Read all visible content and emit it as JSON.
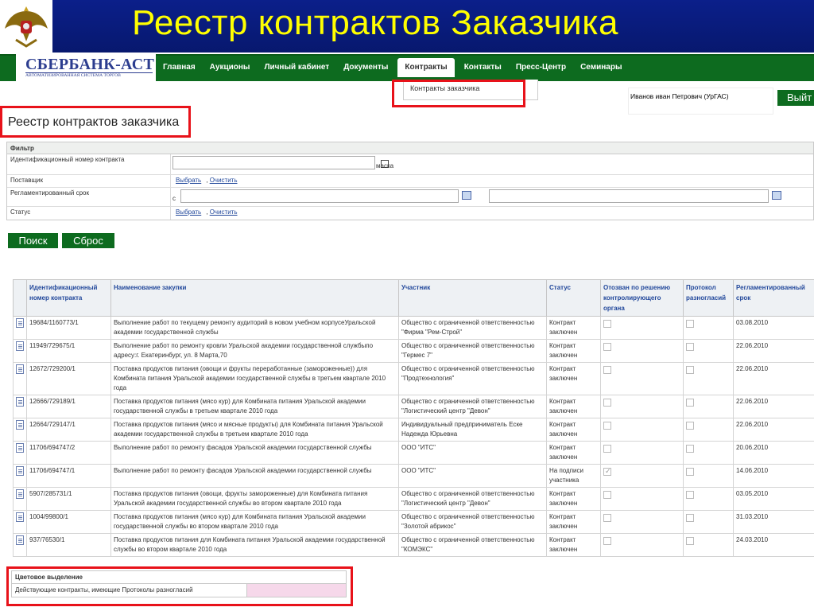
{
  "slide": {
    "title": "Реестр контрактов Заказчика"
  },
  "logo": {
    "main": "СБЕРБАНК-АСТ",
    "sub": "АВТОМАТИЗИРОВАННАЯ СИСТЕМА ТОРГОВ"
  },
  "nav": {
    "items": [
      {
        "label": "Главная"
      },
      {
        "label": "Аукционы"
      },
      {
        "label": "Личный кабинет"
      },
      {
        "label": "Документы"
      },
      {
        "label": "Контракты",
        "active": true
      },
      {
        "label": "Контакты"
      },
      {
        "label": "Пресс-Центр"
      },
      {
        "label": "Семинары"
      }
    ],
    "dropdown_item": "Контракты заказчика"
  },
  "user": {
    "name": "Иванов иван Петрович (УрГАС)",
    "logout": "Выйт"
  },
  "page": {
    "title": "Реестр контрактов заказчика"
  },
  "filter": {
    "header": "Фильтр",
    "contract_number_label": "Идентификационный номер контракта",
    "mask_label": "маска",
    "supplier_label": "Поставщик",
    "reg_term_label": "Регламентированный срок",
    "from_label": "с",
    "status_label": "Статус",
    "select_link": "Выбрать",
    "clear_link": "Очистить"
  },
  "buttons": {
    "search": "Поиск",
    "reset": "Сброс"
  },
  "table": {
    "headers": [
      "Идентификационный номер контракта",
      "Наименование закупки",
      "Участник",
      "Статус",
      "Отозван по решению контролирующего органа",
      "Протокол разногласий",
      "Регламентированный срок"
    ],
    "rows": [
      {
        "num": "19684/1160773/1",
        "name": "Выполнение работ по текущему ремонту аудиторий в новом учебном корпусеУральской академии государственной службы",
        "participant": "Общество с ограниченной ответственностью \"Фирма \"Рем-Строй\"",
        "status": "Контракт заключен",
        "revoked": false,
        "protocol": false,
        "date": "03.08.2010"
      },
      {
        "num": "11949/729675/1",
        "name": "Выполнение работ по ремонту кровли Уральской академии государственной службыпо адресу:г. Екатеринбург, ул. 8 Марта,70",
        "participant": "Общество с ограниченной ответственностью \"Гермес 7\"",
        "status": "Контракт заключен",
        "revoked": false,
        "protocol": false,
        "date": "22.06.2010"
      },
      {
        "num": "12672/729200/1",
        "name": "Поставка продуктов питания (овощи и фрукты переработанные (замороженные)) для Комбината питания Уральской академии государственной службы в третьем квартале 2010 года",
        "participant": "Общество с ограниченной ответственностью \"Продтехнология\"",
        "status": "Контракт заключен",
        "revoked": false,
        "protocol": false,
        "date": "22.06.2010"
      },
      {
        "num": "12666/729189/1",
        "name": "Поставка продуктов питания (мясо кур) для Комбината питания Уральской академии государственной службы в третьем квартале 2010 года",
        "participant": "Общество с ограниченной ответственностью \"Логистический центр \"Девон\"",
        "status": "Контракт заключен",
        "revoked": false,
        "protocol": false,
        "date": "22.06.2010"
      },
      {
        "num": "12664/729147/1",
        "name": "Поставка продуктов питания (мясо и мясные продукты) для Комбината питания Уральской академии государственной службы в третьем квартале 2010 года",
        "participant": "Индивидуальный предприниматель Еске Надежда Юрьевна",
        "status": "Контракт заключен",
        "revoked": false,
        "protocol": false,
        "date": "22.06.2010"
      },
      {
        "num": "11706/694747/2",
        "name": "Выполнение работ по ремонту фасадов Уральской академии государственной службы",
        "participant": "ООО \"ИТС\"",
        "status": "Контракт заключен",
        "revoked": false,
        "protocol": false,
        "date": "20.06.2010"
      },
      {
        "num": "11706/694747/1",
        "name": "Выполнение работ по ремонту фасадов Уральской академии государственной службы",
        "participant": "ООО \"ИТС\"",
        "status": "На подписи участника",
        "revoked": true,
        "protocol": false,
        "date": "14.06.2010"
      },
      {
        "num": "5907/285731/1",
        "name": "Поставка продуктов питания (овощи, фрукты замороженные) для Комбината питания Уральской академии государственной службы во втором квартале 2010 года",
        "participant": "Общество с ограниченной ответственностью \"Логистический центр \"Девон\"",
        "status": "Контракт заключен",
        "revoked": false,
        "protocol": false,
        "date": "03.05.2010"
      },
      {
        "num": "1004/99800/1",
        "name": "Поставка продуктов питания (мясо кур) для Комбината питания Уральской академии государственной службы во втором квартале 2010 года",
        "participant": "Общество с ограниченной ответственностью \"Золотой абрикос\"",
        "status": "Контракт заключен",
        "revoked": false,
        "protocol": false,
        "date": "31.03.2010"
      },
      {
        "num": "937/76530/1",
        "name": "Поставка продуктов питания для Комбината питания Уральской академии государственной службы во втором квартале 2010 года",
        "participant": "Общество с ограниченной ответственностью \"КОМЭКС\"",
        "status": "Контракт заключен",
        "revoked": false,
        "protocol": false,
        "date": "24.03.2010"
      }
    ]
  },
  "legend": {
    "header": "Цветовое выделение",
    "row_label": "Действующие контракты, имеющие Протоколы разногласий",
    "swatch_color": "#f6d8ea"
  },
  "colors": {
    "brand_green": "#0d6b1f",
    "slide_blue": "#0b1f8a",
    "title_yellow": "#ffff00",
    "highlight_red": "#e8121a"
  }
}
